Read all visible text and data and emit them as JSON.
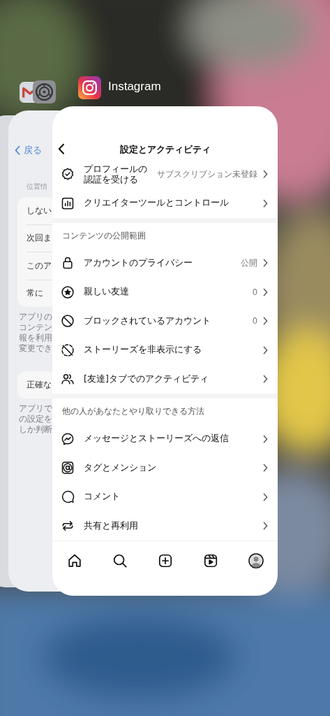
{
  "app_labels": [
    {
      "name": "Instagram"
    }
  ],
  "settings_card": {
    "back_button": "戻る",
    "section_header": "位置情",
    "options": [
      "しない",
      "次回ま",
      "このア",
      "常に"
    ],
    "footnote_lines": [
      "アプリの",
      "コンテン",
      "報を利用",
      "変更でき"
    ],
    "precise_option": "正確な",
    "precise_footnote_lines": [
      "アプリで",
      "の設定を",
      "しか判断"
    ]
  },
  "instagram_card": {
    "title": "設定とアクティビティ",
    "top_rows": [
      {
        "kind": "twoline",
        "label": "プロフィールの",
        "label_line2": "認証を受ける",
        "value": "サブスクリプション未登録"
      },
      {
        "kind": "nav",
        "label": "クリエイターツールとコントロール"
      }
    ],
    "sections": [
      {
        "header": "コンテンツの公開範囲",
        "rows": [
          {
            "kind": "nav",
            "label": "アカウントのプライバシー",
            "value": "公開"
          },
          {
            "kind": "nav",
            "label": "親しい友達",
            "value": "0"
          },
          {
            "kind": "nav",
            "label": "ブロックされているアカウント",
            "value": "0"
          },
          {
            "kind": "nav",
            "label": "ストーリーズを非表示にする"
          },
          {
            "kind": "nav",
            "label": "[友達]タブでのアクティビティ"
          }
        ]
      },
      {
        "header": "他の人があなたとやり取りできる方法",
        "rows": [
          {
            "kind": "nav",
            "label": "メッセージとストーリーズへの返信"
          },
          {
            "kind": "nav",
            "label": "タグとメンション"
          },
          {
            "kind": "nav",
            "label": "コメント"
          },
          {
            "kind": "nav",
            "label": "共有と再利用"
          }
        ]
      }
    ]
  }
}
